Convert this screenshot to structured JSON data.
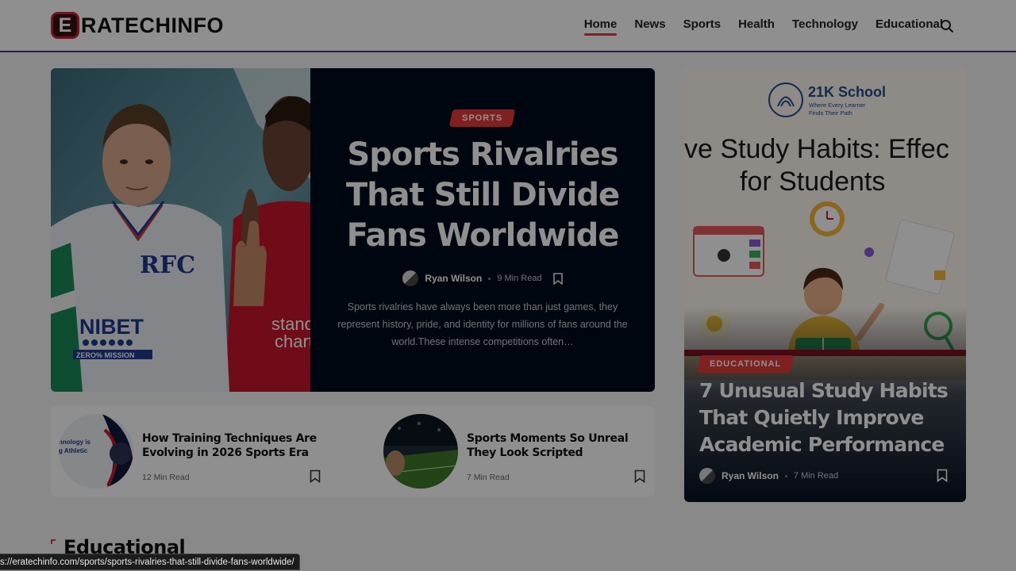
{
  "header": {
    "logo_mark": "E",
    "logo_text": "RATECHINFO",
    "nav": [
      "Home",
      "News",
      "Sports",
      "Health",
      "Technology",
      "Educational"
    ],
    "active_nav": "Home"
  },
  "hero": {
    "category": "SPORTS",
    "title": "Sports Rivalries That Still Divide Fans Worldwide",
    "author": "Ryan Wilson",
    "read_time": "9 Min Read",
    "excerpt": "Sports rivalries have always been more than just games, they represent history, pride, and identity for millions of fans around the world.These intense competitions often…",
    "image_text": {
      "sponsor_left": "NIBET",
      "sponsor_left_sub": "ZERO% MISSION",
      "sponsor_right": "stand",
      "sponsor_right_2": "chart"
    }
  },
  "small_articles": [
    {
      "title": "How Training Techniques Are Evolving in 2026 Sports Era",
      "read_time": "12 Min Read",
      "thumb_text": "hnology is\ng Athletic"
    },
    {
      "title": "Sports Moments So Unreal They Look Scripted",
      "read_time": "7 Min Read"
    }
  ],
  "feature": {
    "school_name": "21K School",
    "school_tagline_1": "Where Every Learner",
    "school_tagline_2": "Finds Their Path",
    "image_heading_1": "ve Study Habits: Effec",
    "image_heading_2": "for Students",
    "category": "EDUCATIONAL",
    "title": "7 Unusual Study Habits That Quietly Improve Academic Performance",
    "author": "Ryan Wilson",
    "read_time": "7 Min Read"
  },
  "section": {
    "title": "Educational"
  },
  "status_bar": {
    "url": "s://eratechinfo.com/sports/sports-rivalries-that-still-divide-fans-worldwide/"
  },
  "colors": {
    "accent": "#e23b3b",
    "header_border": "#5b2a86",
    "hero_bg": "#000c1c"
  }
}
